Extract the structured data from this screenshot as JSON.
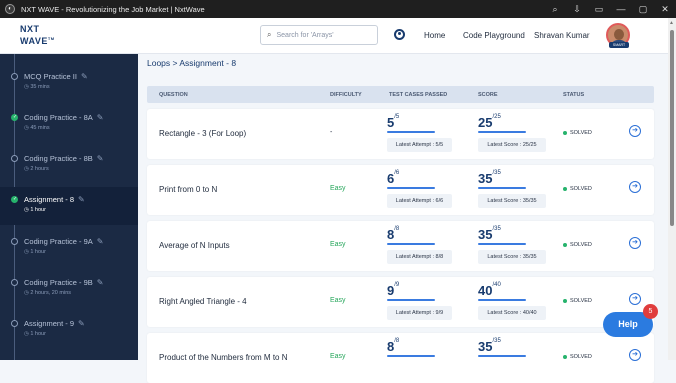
{
  "window": {
    "title": "NXT WAVE - Revolutionizing the Job Market | NxtWave",
    "controls": [
      "⌕",
      "⇩",
      "▭",
      "—",
      "▢",
      "✕"
    ]
  },
  "header": {
    "logo_line1": "NXT",
    "logo_line2": "WAVE",
    "logo_tm": "TM",
    "search_placeholder": "Search for 'Arrays'",
    "nav": [
      "Home",
      "Code Playground"
    ],
    "user_name": "Shravan Kumar",
    "avatar_badge": "SMART"
  },
  "sidebar": {
    "items": [
      {
        "title": "MCQ Practice II",
        "duration": "35 mins",
        "done": false,
        "active": false
      },
      {
        "title": "Coding Practice - 8A",
        "duration": "45 mins",
        "done": true,
        "active": false
      },
      {
        "title": "Coding Practice - 8B",
        "duration": "2 hours",
        "done": false,
        "active": false
      },
      {
        "title": "Assignment - 8",
        "duration": "1 hour",
        "done": true,
        "active": true
      },
      {
        "title": "Coding Practice - 9A",
        "duration": "1 hour",
        "done": false,
        "active": false
      },
      {
        "title": "Coding Practice - 9B",
        "duration": "2 hours, 20 mins",
        "done": false,
        "active": false
      },
      {
        "title": "Assignment - 9",
        "duration": "1 hour",
        "done": false,
        "active": false
      }
    ]
  },
  "main": {
    "breadcrumb": "Loops > Assignment - 8",
    "columns": [
      "QUESTION",
      "DIFFICULTY",
      "TEST CASES PASSED",
      "SCORE",
      "STATUS"
    ],
    "rows": [
      {
        "question": "Rectangle - 3 (For Loop)",
        "difficulty": "-",
        "tc_passed": "5",
        "tc_total": "/5",
        "latest_attempt": "Latest Attempt : 5/5",
        "score": "25",
        "score_total": "/25",
        "latest_score": "Latest Score : 25/25",
        "status": "SOLVED"
      },
      {
        "question": "Print from 0 to N",
        "difficulty": "Easy",
        "tc_passed": "6",
        "tc_total": "/6",
        "latest_attempt": "Latest Attempt : 6/6",
        "score": "35",
        "score_total": "/35",
        "latest_score": "Latest Score : 35/35",
        "status": "SOLVED"
      },
      {
        "question": "Average of N Inputs",
        "difficulty": "Easy",
        "tc_passed": "8",
        "tc_total": "/8",
        "latest_attempt": "Latest Attempt : 8/8",
        "score": "35",
        "score_total": "/35",
        "latest_score": "Latest Score : 35/35",
        "status": "SOLVED"
      },
      {
        "question": "Right Angled Triangle - 4",
        "difficulty": "Easy",
        "tc_passed": "9",
        "tc_total": "/9",
        "latest_attempt": "Latest Attempt : 9/9",
        "score": "40",
        "score_total": "/40",
        "latest_score": "Latest Score : 40/40",
        "status": "SOLVED"
      },
      {
        "question": "Product of the Numbers from M to N",
        "difficulty": "Easy",
        "tc_passed": "8",
        "tc_total": "/8",
        "latest_attempt": "",
        "score": "35",
        "score_total": "/35",
        "latest_score": "",
        "status": "SOLVED"
      }
    ]
  },
  "help": {
    "label": "Help",
    "badge": "5"
  },
  "colors": {
    "accent": "#2b7be0",
    "sidebar": "#1b2a44",
    "success": "#26b36c",
    "brand": "#183b6e"
  }
}
